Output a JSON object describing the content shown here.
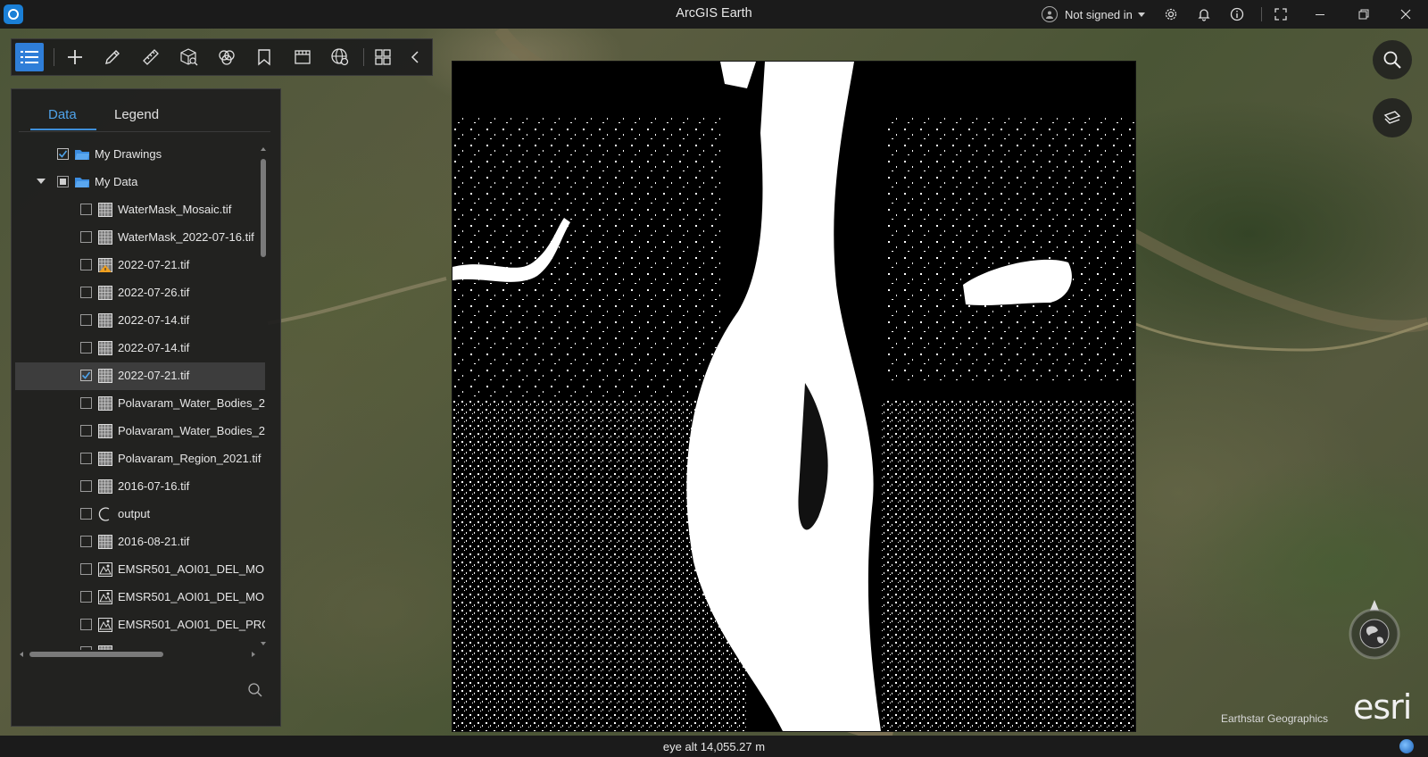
{
  "window": {
    "title": "ArcGIS Earth",
    "account_label": "Not signed in",
    "buttons": [
      "settings-icon",
      "notifications-icon",
      "info-icon",
      "fullscreen-icon",
      "minimize-icon",
      "restore-icon",
      "close-icon"
    ]
  },
  "toolbar": {
    "tools": [
      "layer-list-icon",
      "add-data-icon",
      "draw-icon",
      "measure-icon",
      "analysis-icon",
      "interactive-icon",
      "bookmark-icon",
      "capture-icon",
      "globe-settings-icon",
      "grid-icon",
      "collapse-icon"
    ],
    "accent": "#2f7ed8"
  },
  "panel": {
    "tabs": [
      {
        "label": "Data",
        "active": true
      },
      {
        "label": "Legend",
        "active": false
      }
    ],
    "items": [
      {
        "label": "My Drawings",
        "checked": true,
        "icon": "folder-icon",
        "indent": 0
      },
      {
        "label": "My Data",
        "checked": "partial",
        "icon": "folder-icon",
        "indent": 0,
        "expanded": true
      },
      {
        "label": "WaterMask_Mosaic.tif",
        "checked": false,
        "icon": "raster-icon",
        "indent": 1
      },
      {
        "label": "WaterMask_2022-07-16.tif",
        "checked": false,
        "icon": "raster-icon",
        "indent": 1
      },
      {
        "label": "2022-07-21.tif",
        "checked": false,
        "icon": "raster-warning-icon",
        "indent": 1
      },
      {
        "label": "2022-07-26.tif",
        "checked": false,
        "icon": "raster-icon",
        "indent": 1
      },
      {
        "label": "2022-07-14.tif",
        "checked": false,
        "icon": "raster-icon",
        "indent": 1
      },
      {
        "label": "2022-07-14.tif",
        "checked": false,
        "icon": "raster-icon",
        "indent": 1
      },
      {
        "label": "2022-07-21.tif",
        "checked": true,
        "icon": "raster-icon",
        "indent": 1,
        "selected": true
      },
      {
        "label": "Polavaram_Water_Bodies_2",
        "checked": false,
        "icon": "raster-icon",
        "indent": 1
      },
      {
        "label": "Polavaram_Water_Bodies_2",
        "checked": false,
        "icon": "raster-icon",
        "indent": 1
      },
      {
        "label": "Polavaram_Region_2021.tif",
        "checked": false,
        "icon": "raster-icon",
        "indent": 1
      },
      {
        "label": "2016-07-16.tif",
        "checked": false,
        "icon": "raster-icon",
        "indent": 1
      },
      {
        "label": "output",
        "checked": false,
        "icon": "loading-icon",
        "indent": 1
      },
      {
        "label": "2016-08-21.tif",
        "checked": false,
        "icon": "raster-icon",
        "indent": 1
      },
      {
        "label": "EMSR501_AOI01_DEL_MO",
        "checked": false,
        "icon": "map-layer-icon",
        "indent": 1
      },
      {
        "label": "EMSR501_AOI01_DEL_MO",
        "checked": false,
        "icon": "map-layer-icon",
        "indent": 1
      },
      {
        "label": "EMSR501_AOI01_DEL_PRC",
        "checked": false,
        "icon": "map-layer-icon",
        "indent": 1
      },
      {
        "label": "",
        "checked": false,
        "icon": "raster-icon",
        "indent": 1
      }
    ]
  },
  "map": {
    "attribution": "Earthstar Geographics",
    "logo_text": "esri"
  },
  "status": {
    "text": "eye alt 14,055.27 m"
  }
}
